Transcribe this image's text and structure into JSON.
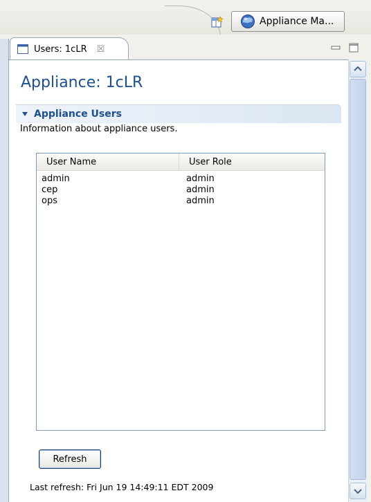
{
  "toolbar": {
    "perspective_label": "Appliance Ma...",
    "open_perspective_icon": "open-perspective-icon",
    "perspective_icon": "globe-icon"
  },
  "tab": {
    "label": "Users: 1cLR",
    "close_glyph": "☒",
    "icon": "view-icon"
  },
  "window_controls": {
    "minimize_icon": "minimize-icon",
    "maximize_icon": "maximize-icon"
  },
  "editor": {
    "title": "Appliance: 1cLR"
  },
  "section": {
    "title": "Appliance Users",
    "description": "Information about appliance users.",
    "expanded": true
  },
  "table": {
    "columns": [
      "User Name",
      "User Role"
    ],
    "rows": [
      [
        "admin",
        "admin"
      ],
      [
        "cep",
        "admin"
      ],
      [
        "ops",
        "admin"
      ]
    ]
  },
  "actions": {
    "refresh_label": "Refresh"
  },
  "status": {
    "last_refresh": "Last refresh: Fri Jun 19 14:49:11 EDT 2009"
  },
  "colors": {
    "title": "#1d4f91",
    "section_header_bg": "#dbe6f3",
    "table_border": "#7f9db9"
  }
}
